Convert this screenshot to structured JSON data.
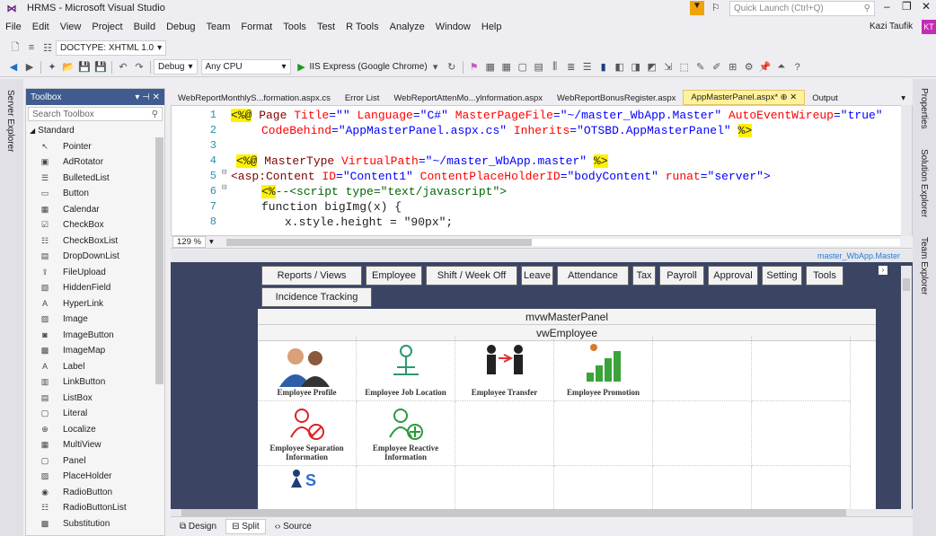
{
  "window": {
    "title": "HRMS - Microsoft Visual Studio",
    "quick_launch": "Quick Launch (Ctrl+Q)",
    "user": "Kazi Taufik",
    "user_initials": "KT"
  },
  "menu": [
    "File",
    "Edit",
    "View",
    "Project",
    "Build",
    "Debug",
    "Team",
    "Format",
    "Tools",
    "Test",
    "R Tools",
    "Analyze",
    "Window",
    "Help"
  ],
  "toolbar1": {
    "doctype": "DOCTYPE: XHTML 1.0"
  },
  "toolbar2": {
    "config": "Debug",
    "platform": "Any CPU",
    "run": "IIS Express (Google Chrome)"
  },
  "side_left": [
    "Server Explorer"
  ],
  "side_right": [
    "Properties",
    "Solution Explorer",
    "Team Explorer"
  ],
  "toolbox": {
    "title": "Toolbox",
    "search": "Search Toolbox",
    "section": "Standard",
    "items": [
      "Pointer",
      "AdRotator",
      "BulletedList",
      "Button",
      "Calendar",
      "CheckBox",
      "CheckBoxList",
      "DropDownList",
      "FileUpload",
      "HiddenField",
      "HyperLink",
      "Image",
      "ImageButton",
      "ImageMap",
      "Label",
      "LinkButton",
      "ListBox",
      "Literal",
      "Localize",
      "MultiView",
      "Panel",
      "PlaceHolder",
      "RadioButton",
      "RadioButtonList",
      "Substitution"
    ]
  },
  "doc_tabs": [
    "WebReportMonthlyS...formation.aspx.cs",
    "Error List",
    "WebReportAttenMo...ylnformation.aspx",
    "WebReportBonusRegister.aspx",
    "AppMasterPanel.aspx*",
    "Output"
  ],
  "code": {
    "lines": [
      "1",
      "2",
      "3",
      "4",
      "5",
      "6",
      "7",
      "8"
    ],
    "l1a": "<%@",
    "l1b": " Page ",
    "l1c": "Title",
    "l1d": "=\"\" ",
    "l1e": "Language",
    "l1f": "=\"C#\" ",
    "l1g": "MasterPageFile",
    "l1h": "=\"~/master_WbApp.Master\" ",
    "l1i": "AutoEventWireup",
    "l1j": "=\"true\"",
    "l2a": "CodeBehind",
    "l2b": "=\"AppMasterPanel.aspx.cs\" ",
    "l2c": "Inherits",
    "l2d": "=\"OTSBD.AppMasterPanel\" ",
    "l2e": "%>",
    "l4a": "<%@",
    "l4b": " MasterType ",
    "l4c": "VirtualPath",
    "l4d": "=\"~/master_WbApp.master\" ",
    "l4e": "%>",
    "l5a": "<asp:Content ",
    "l5b": "ID",
    "l5c": "=\"Content1\" ",
    "l5d": "ContentPlaceHolderID",
    "l5e": "=\"bodyContent\" ",
    "l5f": "runat",
    "l5g": "=\"server\">",
    "l6a": "<%",
    "l6b": "--<script type=\"text/javascript\">",
    "l7": "function bigImg(x) {",
    "l8": "x.style.height = \"90px\";"
  },
  "zoom": "129 %",
  "design": {
    "master_label": "master_WbApp.Master",
    "tabs": [
      "Reports / Views",
      "Employee",
      "Shift / Week Off",
      "Leave",
      "Attendance",
      "Tax",
      "Payroll",
      "Approval",
      "Setting",
      "Tools"
    ],
    "tab2": "Incidence Tracking",
    "mv": "mvwMasterPanel",
    "vw": "vwEmployee",
    "cells": [
      "Employee Profile",
      "Employee Job Location",
      "Employee Transfer",
      "Employee Promotion",
      "Employee Separation Information",
      "Employee Reactive Information"
    ]
  },
  "bottom": [
    "Design",
    "Split",
    "Source"
  ]
}
